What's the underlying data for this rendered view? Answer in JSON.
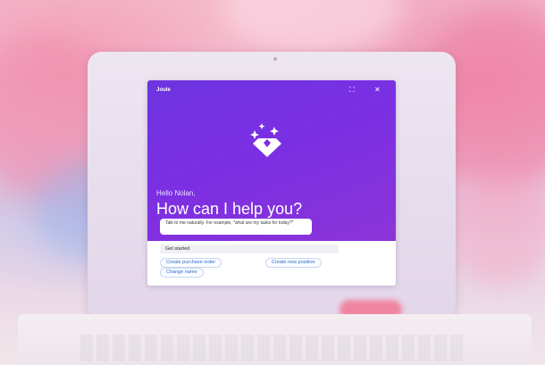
{
  "joule": {
    "title": "Joule",
    "expand_icon": "expand-icon",
    "close_icon": "close-icon",
    "logo_icon": "diamond-sparkle-icon",
    "greeting": "Hello Nolan,",
    "headline": "How can I help you?",
    "suggestion_text": "Talk to me naturally. For example, \"what are my tasks for today?\"",
    "get_started": "Get started",
    "chips": [
      {
        "label": "Create purchase order"
      },
      {
        "label": "Create new position"
      },
      {
        "label": "Change name"
      }
    ],
    "colors": {
      "accent_purple": "#7b2fe3",
      "chip_text": "#2f6fd0",
      "brand_pink": "#f46a88"
    }
  }
}
